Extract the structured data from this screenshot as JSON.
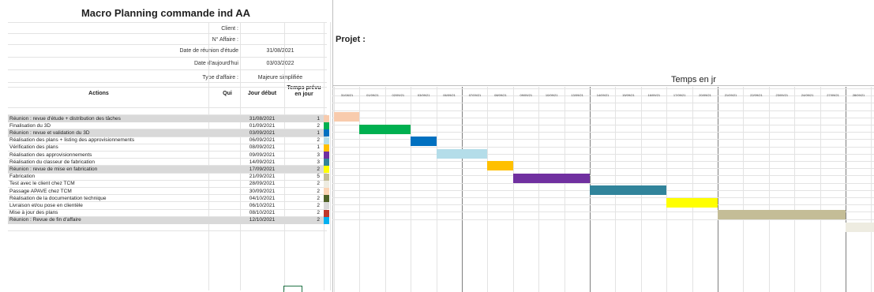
{
  "title": "Macro Planning commande ind AA",
  "info": [
    {
      "label": "Client :",
      "value": ""
    },
    {
      "label": "N° Affaire :",
      "value": ""
    },
    {
      "label": "Date de réunion d'étude",
      "value": "31/08/2021"
    },
    {
      "label": "Date d'aujourd'hui",
      "value": "03/03/2022"
    },
    {
      "label": "Type d'affaire :",
      "value": "Majeure simplifiée"
    }
  ],
  "headers": {
    "actions": "Actions",
    "qui": "Qui",
    "jour_debut": "Jour début",
    "temps": "Temps prévu en jour"
  },
  "projet_label": "Projet :",
  "temps_en_jr": "Temps en jr",
  "dates": [
    "31/08/21",
    "01/09/21",
    "02/09/21",
    "03/09/21",
    "06/09/21",
    "07/09/21",
    "08/09/21",
    "09/09/21",
    "10/09/21",
    "13/09/21",
    "14/09/21",
    "15/09/21",
    "16/09/21",
    "17/09/21",
    "20/09/21",
    "21/09/21",
    "22/09/21",
    "23/09/21",
    "24/09/21",
    "27/09/21",
    "28/09/21"
  ],
  "tasks": [
    {
      "name": "Réunion : revue d'étude + distribution des tâches",
      "start": "31/08/2021",
      "duration": 1,
      "color": "#f8cbad",
      "highlight": true,
      "bar_start": 0,
      "bar_days": 1
    },
    {
      "name": "Finalisation du 3D",
      "start": "01/09/2021",
      "duration": 2,
      "color": "#00b050",
      "highlight": false,
      "bar_start": 1,
      "bar_days": 2
    },
    {
      "name": "Réunion : revue et validation du 3D",
      "start": "03/09/2021",
      "duration": 1,
      "color": "#0070c0",
      "highlight": true,
      "bar_start": 3,
      "bar_days": 1
    },
    {
      "name": "Réalisation des plans + listing des approvisionnements",
      "start": "06/09/2021",
      "duration": 2,
      "color": "#b4dde9",
      "highlight": false,
      "bar_start": 4,
      "bar_days": 2
    },
    {
      "name": "Vérification des plans",
      "start": "08/09/2021",
      "duration": 1,
      "color": "#ffc000",
      "highlight": false,
      "bar_start": 6,
      "bar_days": 1
    },
    {
      "name": "Réalisation des approvisionnements",
      "start": "09/09/2021",
      "duration": 3,
      "color": "#7030a0",
      "highlight": false,
      "bar_start": 7,
      "bar_days": 3
    },
    {
      "name": "Réalisation du classeur de fabrication",
      "start": "14/09/2021",
      "duration": 3,
      "color": "#31849b",
      "highlight": false,
      "bar_start": 10,
      "bar_days": 3
    },
    {
      "name": "Réunion : revue de mise en fabrication",
      "start": "17/09/2021",
      "duration": 2,
      "color": "#ffff00",
      "highlight": true,
      "bar_start": 13,
      "bar_days": 2
    },
    {
      "name": "Fabrication",
      "start": "21/09/2021",
      "duration": 5,
      "color": "#c4bd97",
      "highlight": false,
      "bar_start": 15,
      "bar_days": 5
    },
    {
      "name": "Test avec le client chez TCM",
      "start": "28/09/2021",
      "duration": 2,
      "color": "#eeece1",
      "highlight": false,
      "bar_start": 20,
      "bar_days": 2
    },
    {
      "name": "Passage APAVE chez TCM",
      "start": "30/09/2021",
      "duration": 2,
      "color": "#fbd4b4",
      "highlight": false,
      "bar_start": null,
      "bar_days": 0
    },
    {
      "name": "Réalisation de la documentation technique",
      "start": "04/10/2021",
      "duration": 2,
      "color": "#4f6228",
      "highlight": false,
      "bar_start": null,
      "bar_days": 0
    },
    {
      "name": "Livraison et/ou pose en clientèle",
      "start": "06/10/2021",
      "duration": 2,
      "color": "#d9d9d9",
      "highlight": false,
      "bar_start": null,
      "bar_days": 0
    },
    {
      "name": "Mise à jour des plans",
      "start": "08/10/2021",
      "duration": 2,
      "color": "#c0392b",
      "highlight": false,
      "bar_start": null,
      "bar_days": 0
    },
    {
      "name": "Réunion : Revue de fin d'affaire",
      "start": "12/10/2021",
      "duration": 2,
      "color": "#00b0f0",
      "highlight": true,
      "bar_start": null,
      "bar_days": 0
    }
  ]
}
